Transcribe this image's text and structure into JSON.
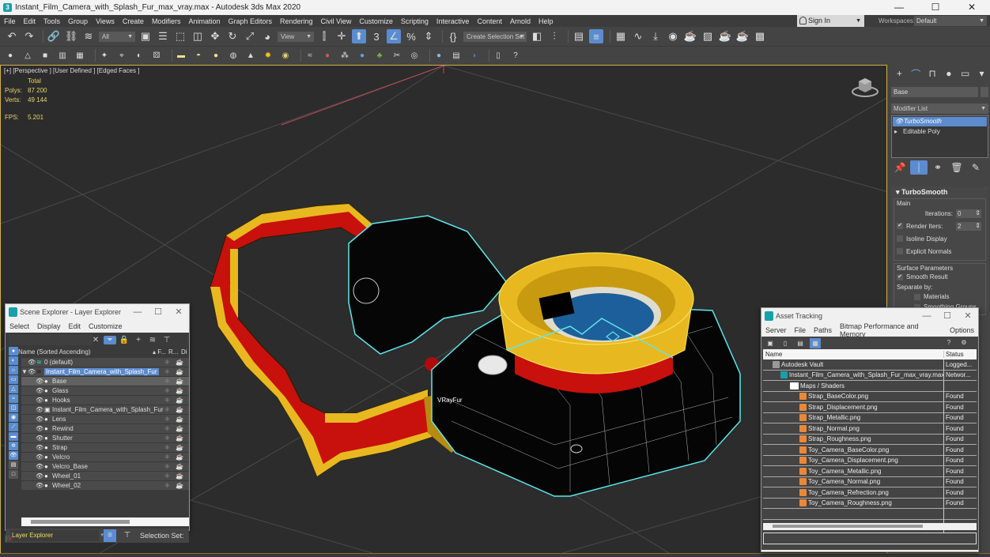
{
  "window": {
    "title": "Instant_Film_Camera_with_Splash_Fur_max_vray.max - Autodesk 3ds Max 2020",
    "controls": [
      "minimize",
      "maximize",
      "close"
    ]
  },
  "menubar": {
    "items": [
      "File",
      "Edit",
      "Tools",
      "Group",
      "Views",
      "Create",
      "Modifiers",
      "Animation",
      "Graph Editors",
      "Rendering",
      "Civil View",
      "Customize",
      "Scripting",
      "Interactive",
      "Content",
      "Arnold",
      "Help"
    ],
    "sign_in": "Sign In",
    "workspaces_label": "Workspaces:",
    "workspaces_value": "Default"
  },
  "toolbar": {
    "selection_filter": "All",
    "ref_coord": "View",
    "named_selection": "Create Selection Set"
  },
  "viewport": {
    "label": "[+] [Perspective ] [User Defined ] [Edged Faces ]",
    "stats_header": "Total",
    "stats": [
      {
        "key": "Polys:",
        "value": "87 200"
      },
      {
        "key": "Verts:",
        "value": "49 144"
      }
    ],
    "fps_key": "FPS:",
    "fps_value": "5.201",
    "object_tag": "VRayFur",
    "colors": {
      "selection": "#5ee6ea",
      "strap_red": "#c8100c",
      "strap_yellow": "#e8b820",
      "body": "#050505"
    }
  },
  "command_panel": {
    "object_name": "Base",
    "modifier_list": "Modifier List",
    "stack": [
      "TurboSmooth",
      "Editable Poly"
    ],
    "rollout": {
      "title": "TurboSmooth",
      "main_label": "Main",
      "iterations_label": "Iterations:",
      "iterations_value": "0",
      "render_iters_label": "Render Iters:",
      "render_iters_value": "2",
      "render_iters_checked": true,
      "isoline_label": "Isoline Display",
      "explicit_normals_label": "Explicit Normals",
      "surface_label": "Surface Parameters",
      "smooth_result_label": "Smooth Result",
      "separate_label": "Separate by:",
      "materials_label": "Materials",
      "smoothing_groups_label": "Smoothing Groups"
    }
  },
  "scene_explorer": {
    "title": "Scene Explorer - Layer Explorer",
    "menu": [
      "Select",
      "Display",
      "Edit",
      "Customize"
    ],
    "col_name": "Name (Sorted Ascending)",
    "col_f": "▴ F...",
    "col_r": "R...",
    "col_d": "Di",
    "rows": [
      {
        "name": "0 (default)",
        "level": 0,
        "type": "layer"
      },
      {
        "name": "Instant_Film_Camera_with_Splash_Fur",
        "level": 0,
        "type": "layer",
        "selected": true
      },
      {
        "name": "Base",
        "level": 1,
        "type": "object",
        "highlight": true
      },
      {
        "name": "Glass",
        "level": 1,
        "type": "object"
      },
      {
        "name": "Hooks",
        "level": 1,
        "type": "object"
      },
      {
        "name": "Instant_Film_Camera_with_Splash_Fur",
        "level": 1,
        "type": "group"
      },
      {
        "name": "Lens",
        "level": 1,
        "type": "object"
      },
      {
        "name": "Rewind",
        "level": 1,
        "type": "object"
      },
      {
        "name": "Shutter",
        "level": 1,
        "type": "object"
      },
      {
        "name": "Strap",
        "level": 1,
        "type": "object"
      },
      {
        "name": "Velcro",
        "level": 1,
        "type": "object"
      },
      {
        "name": "Velcro_Base",
        "level": 1,
        "type": "object"
      },
      {
        "name": "Wheel_01",
        "level": 1,
        "type": "object"
      },
      {
        "name": "Wheel_02",
        "level": 1,
        "type": "object"
      }
    ],
    "footer_explorer": "Layer Explorer",
    "footer_selection_set": "Selection Set:"
  },
  "asset_tracking": {
    "title": "Asset Tracking",
    "menu": [
      "Server",
      "File",
      "Paths",
      "Bitmap Performance and Memory",
      "Options"
    ],
    "col_name": "Name",
    "col_status": "Status",
    "rows": [
      {
        "name": "Autodesk Vault",
        "status": "Logged...",
        "level": 0,
        "icon": "vault"
      },
      {
        "name": "Instant_Film_Camera_with_Splash_Fur_max_vray.max",
        "status": "Networ...",
        "level": 1,
        "icon": "max"
      },
      {
        "name": "Maps / Shaders",
        "status": "",
        "level": 2,
        "icon": "maps"
      },
      {
        "name": "Strap_BaseColor.png",
        "status": "Found",
        "level": 3,
        "icon": "png"
      },
      {
        "name": "Strap_Displacement.png",
        "status": "Found",
        "level": 3,
        "icon": "png"
      },
      {
        "name": "Strap_Metallic.png",
        "status": "Found",
        "level": 3,
        "icon": "png"
      },
      {
        "name": "Strap_Normal.png",
        "status": "Found",
        "level": 3,
        "icon": "png"
      },
      {
        "name": "Strap_Roughness.png",
        "status": "Found",
        "level": 3,
        "icon": "png"
      },
      {
        "name": "Toy_Camera_BaseColor.png",
        "status": "Found",
        "level": 3,
        "icon": "png"
      },
      {
        "name": "Toy_Camera_Displacement.png",
        "status": "Found",
        "level": 3,
        "icon": "png"
      },
      {
        "name": "Toy_Camera_Metallic.png",
        "status": "Found",
        "level": 3,
        "icon": "png"
      },
      {
        "name": "Toy_Camera_Normal.png",
        "status": "Found",
        "level": 3,
        "icon": "png"
      },
      {
        "name": "Toy_Camera_Refrection.png",
        "status": "Found",
        "level": 3,
        "icon": "png"
      },
      {
        "name": "Toy_Camera_Roughness.png",
        "status": "Found",
        "level": 3,
        "icon": "png"
      }
    ]
  }
}
